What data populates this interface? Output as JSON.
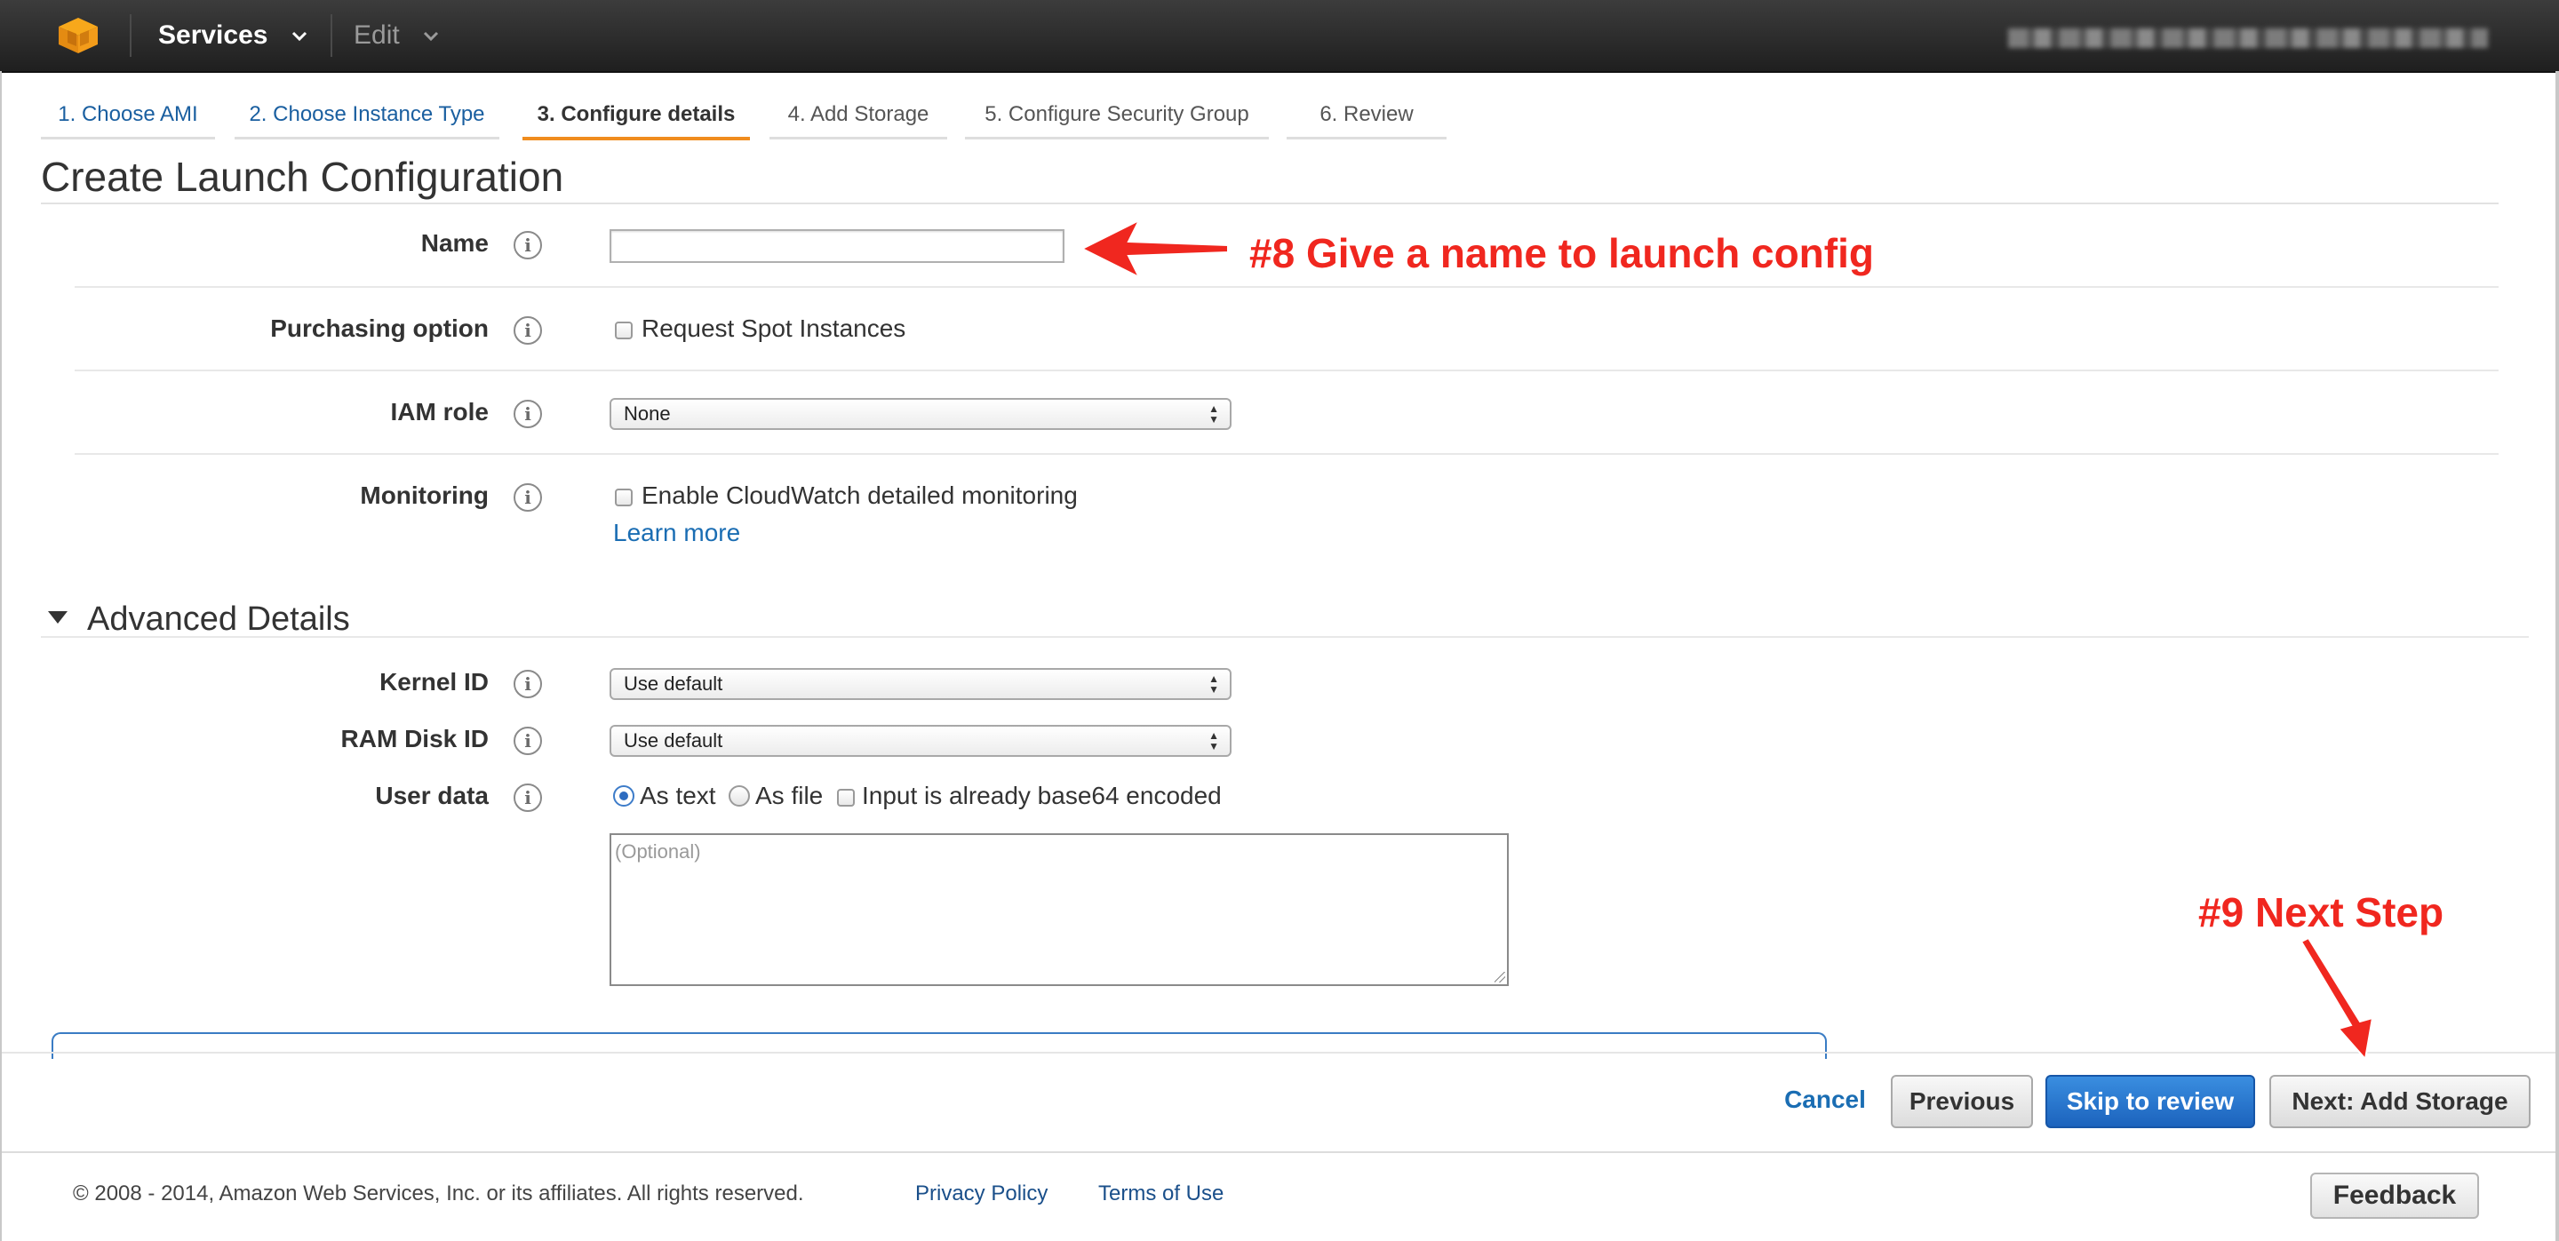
{
  "topnav": {
    "services_label": "Services",
    "edit_label": "Edit",
    "logo_icon": "aws-cube-icon",
    "account_redacted": true
  },
  "wizard": {
    "tabs": [
      {
        "label": "1. Choose AMI",
        "state": "done"
      },
      {
        "label": "2. Choose Instance Type",
        "state": "done"
      },
      {
        "label": "3. Configure details",
        "state": "active"
      },
      {
        "label": "4. Add Storage",
        "state": "future"
      },
      {
        "label": "5. Configure Security Group",
        "state": "future"
      },
      {
        "label": "6. Review",
        "state": "future"
      }
    ],
    "active_color": "#f08c1e"
  },
  "page": {
    "title": "Create Launch Configuration"
  },
  "form": {
    "name": {
      "label": "Name",
      "value": ""
    },
    "purchasing": {
      "label": "Purchasing option",
      "checkbox_label": "Request Spot Instances",
      "checked": false
    },
    "iam_role": {
      "label": "IAM role",
      "selected": "None"
    },
    "monitoring": {
      "label": "Monitoring",
      "checkbox_label": "Enable CloudWatch detailed monitoring",
      "checked": false,
      "learn_more": "Learn more"
    }
  },
  "advanced": {
    "heading": "Advanced Details",
    "kernel": {
      "label": "Kernel ID",
      "selected": "Use default"
    },
    "ramdisk": {
      "label": "RAM Disk ID",
      "selected": "Use default"
    },
    "user_data": {
      "label": "User data",
      "as_text": "As text",
      "as_file": "As file",
      "base64": "Input is already base64 encoded",
      "selected": "As text",
      "placeholder": "(Optional)"
    }
  },
  "actions": {
    "cancel": "Cancel",
    "previous": "Previous",
    "skip": "Skip to review",
    "next": "Next: Add Storage",
    "primary_color": "#1c63bd"
  },
  "footer": {
    "copyright": "© 2008 - 2014, Amazon Web Services, Inc. or its affiliates. All rights reserved.",
    "privacy": "Privacy Policy",
    "terms": "Terms of Use",
    "feedback": "Feedback"
  },
  "annotations": {
    "step8": "#8 Give a name to launch config",
    "step9": "#9 Next Step",
    "color": "#f0271f"
  }
}
